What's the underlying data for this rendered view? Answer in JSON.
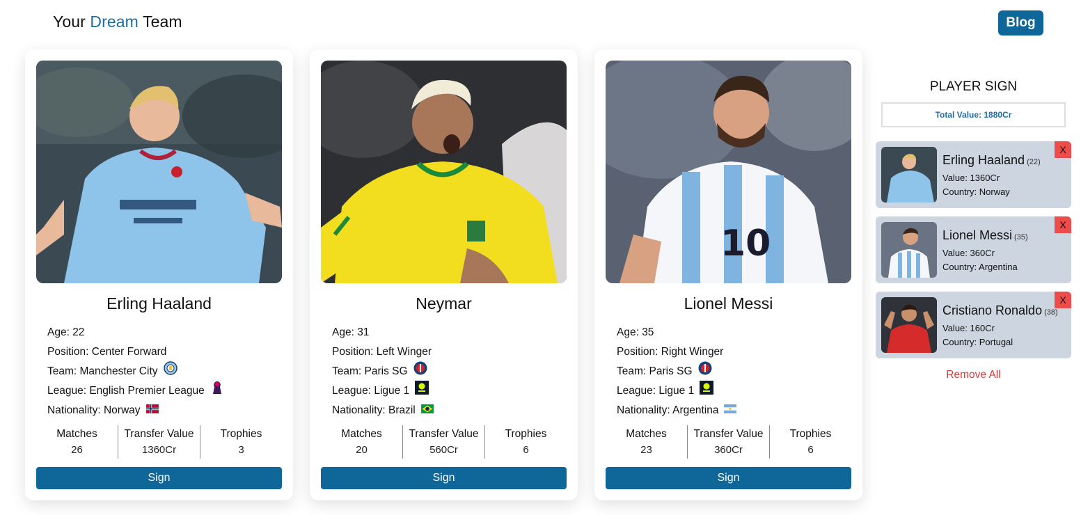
{
  "header": {
    "title_prefix": "Your",
    "title_accent": "Dream",
    "title_suffix": "Team",
    "blog_label": "Blog"
  },
  "stat_labels": {
    "matches": "Matches",
    "transfer": "Transfer Value",
    "trophies": "Trophies"
  },
  "sign_label": "Sign",
  "cards": [
    {
      "name": "Erling Haaland",
      "age": "Age: 22",
      "position": "Position: Center Forward",
      "team": "Team: Manchester City",
      "league": "League: English Premier League",
      "nationality": "Nationality: Norway",
      "matches": "26",
      "transfer": "1360Cr",
      "trophies": "3"
    },
    {
      "name": "Neymar",
      "age": "Age: 31",
      "position": "Position: Left Winger",
      "team": "Team: Paris SG",
      "league": "League: Ligue 1",
      "nationality": "Nationality: Brazil",
      "matches": "20",
      "transfer": "560Cr",
      "trophies": "6"
    },
    {
      "name": "Lionel Messi",
      "age": "Age: 35",
      "position": "Position: Right Winger",
      "team": "Team: Paris SG",
      "league": "League: Ligue 1",
      "nationality": "Nationality: Argentina",
      "matches": "23",
      "transfer": "360Cr",
      "trophies": "6"
    }
  ],
  "panel": {
    "title": "PLAYER SIGN",
    "total": "Total Value: 1880Cr",
    "close_label": "X",
    "remove_all": "Remove All",
    "signed": [
      {
        "name": "Erling Haaland",
        "age": "(22)",
        "value": "Value: 1360Cr",
        "country": "Country: Norway"
      },
      {
        "name": "Lionel Messi",
        "age": "(35)",
        "value": "Value: 360Cr",
        "country": "Country: Argentina"
      },
      {
        "name": "Cristiano Ronaldo",
        "age": "(38)",
        "value": "Value: 160Cr",
        "country": "Country: Portugal"
      }
    ]
  },
  "colors": {
    "primary": "#0e6699",
    "accent_text": "#1c6ea4",
    "danger": "#ee4b4b",
    "remove": "#d63a3a",
    "signed_bg": "#cdd5e0"
  },
  "icons": {
    "team": [
      "man-city-crest-icon",
      "psg-crest-icon",
      "psg-crest-icon"
    ],
    "league": [
      "premier-league-icon",
      "ligue-1-icon",
      "ligue-1-icon"
    ],
    "flag": [
      "norway-flag-icon",
      "brazil-flag-icon",
      "argentina-flag-icon"
    ]
  }
}
